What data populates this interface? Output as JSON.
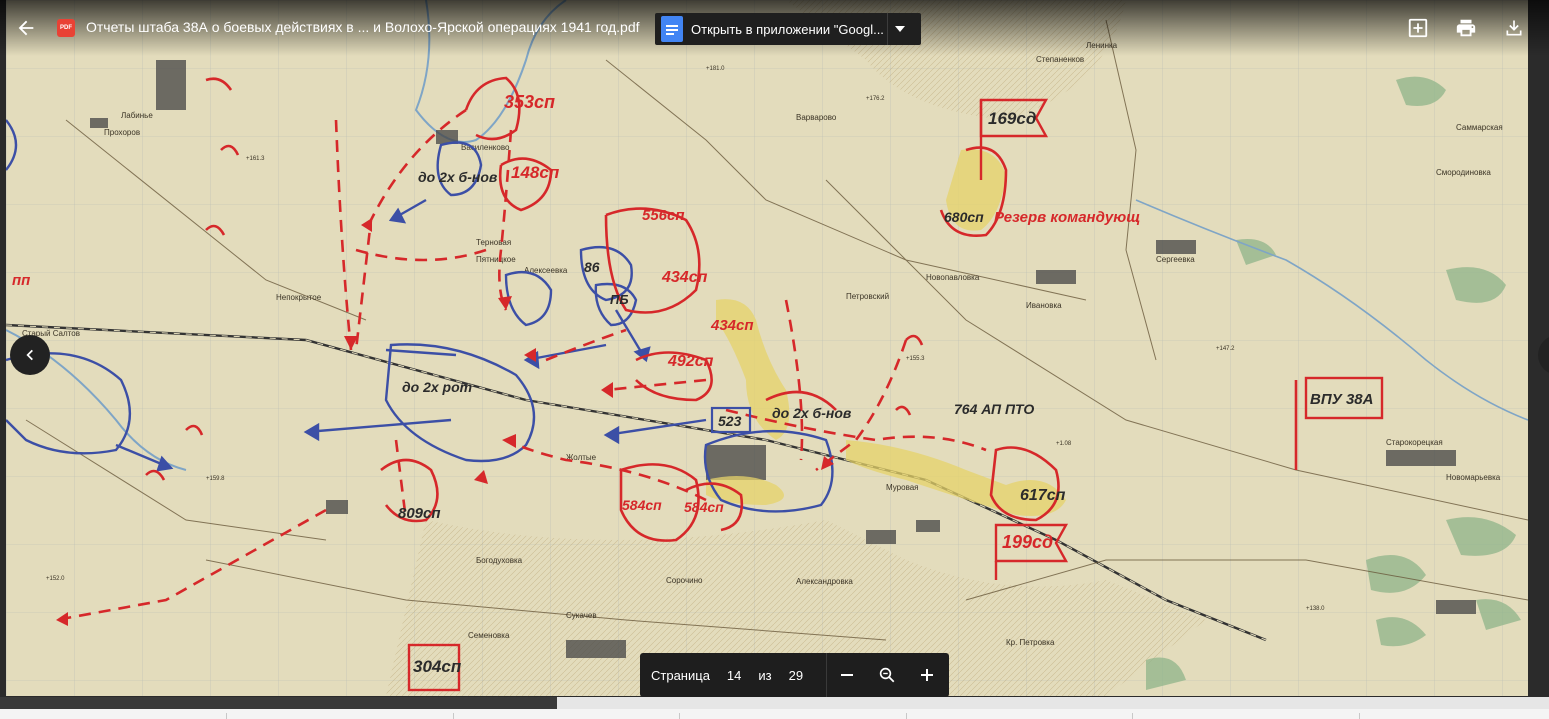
{
  "viewer": {
    "file_title": "Отчеты штаба 38А о боевых действиях в ... и Волохо-Ярской операциях 1941 год.pdf",
    "file_type_badge": "PDF",
    "open_with_label": "Открыть в приложении \"Googl...",
    "icons": {
      "back": "arrow-left-icon",
      "add": "add-to-drive-icon",
      "print": "print-icon",
      "download": "download-icon",
      "prev": "chevron-left-icon",
      "zoom_out": "minus-icon",
      "zoom": "magnifier-icon",
      "zoom_in": "plus-icon"
    }
  },
  "pager": {
    "label": "Страница",
    "current": "14",
    "of": "из",
    "total": "29"
  },
  "map": {
    "unit_labels": [
      "353сп",
      "148сп",
      "до 2х б-нов",
      "556сп",
      "434сп",
      "86",
      "ПБ",
      "434сп",
      "492сп",
      "до 2х рот",
      "523",
      "до 2х б-нов",
      "764 АП ПТО",
      "617сп",
      "199сд",
      "584сп",
      "584сп",
      "809сп",
      "169сд",
      "680сп",
      "Резерв командующ",
      "ВПУ 38А",
      "304сп",
      "пп"
    ],
    "place_names": [
      "Лабинье",
      "Прохоров",
      "Василенково",
      "Терновая",
      "Пятницкое",
      "Алексеевка",
      "Новопавловка",
      "Петровский",
      "Ивановка",
      "Сергеевка",
      "Непокрытое",
      "Старый Салтов",
      "Богодуховка",
      "Семеновка",
      "Сукачев",
      "Сорочино",
      "Александровка",
      "Кр. Петровка",
      "Муровая",
      "Старокорецкая",
      "Смородиновка",
      "Саммарская",
      "Ленинка",
      "Степаненков",
      "Жолтые",
      "Варварово",
      "Новомарьевка"
    ],
    "colors": {
      "paper": "#e3dcbc",
      "red_ink": "#d6282a",
      "blue_ink": "#3c4fa6",
      "yellow_fill": "#e6d36a",
      "green_forest": "#8fb48a",
      "river": "#7fa5c6"
    }
  }
}
